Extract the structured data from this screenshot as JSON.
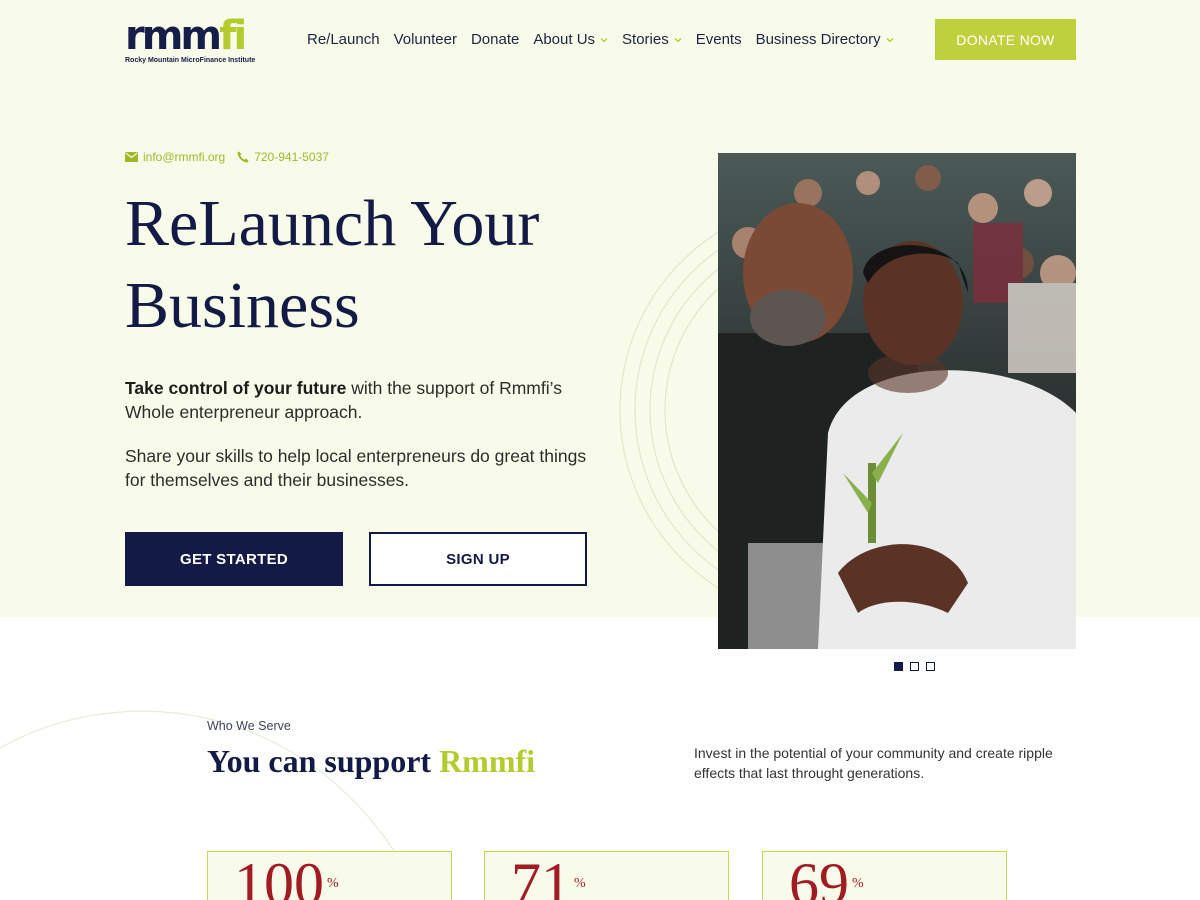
{
  "logo": {
    "word_dark": "rmm",
    "word_green": "fi",
    "subtitle": "Rocky Mountain MicroFinance Institute"
  },
  "nav": {
    "items": [
      {
        "label": "Re/Launch",
        "dropdown": false
      },
      {
        "label": "Volunteer",
        "dropdown": false
      },
      {
        "label": "Donate",
        "dropdown": false
      },
      {
        "label": "About Us",
        "dropdown": true
      },
      {
        "label": "Stories",
        "dropdown": true
      },
      {
        "label": "Events",
        "dropdown": false
      },
      {
        "label": "Business Directory",
        "dropdown": true
      }
    ],
    "donate_label": "DONATE NOW"
  },
  "hero": {
    "email": "info@rmmfi.org",
    "phone": "720-941-5037",
    "title": "ReLaunch Your Business",
    "p1_bold": "Take control of your future",
    "p1_rest": " with the support of Rmmfi’s Whole enterpreneur approach.",
    "p2": "Share your skills to help local enterpreneurs do great things for themselves and their businesses.",
    "cta_primary": "GET STARTED",
    "cta_secondary": "SIGN UP",
    "slides_total": 3,
    "slide_active": 1
  },
  "serve": {
    "eyebrow": "Who We Serve",
    "title_plain": "You can support ",
    "title_highlight": "Rmmfi",
    "description": "Invest in the potential of your community and create ripple effects that last throught generations."
  },
  "stats": [
    {
      "value": "100",
      "unit": "%"
    },
    {
      "value": "71",
      "unit": "%"
    },
    {
      "value": "69",
      "unit": "%"
    }
  ],
  "colors": {
    "navy": "#121a45",
    "green": "#bed13c",
    "cream": "#f8fbe9",
    "red": "#a01c22"
  }
}
